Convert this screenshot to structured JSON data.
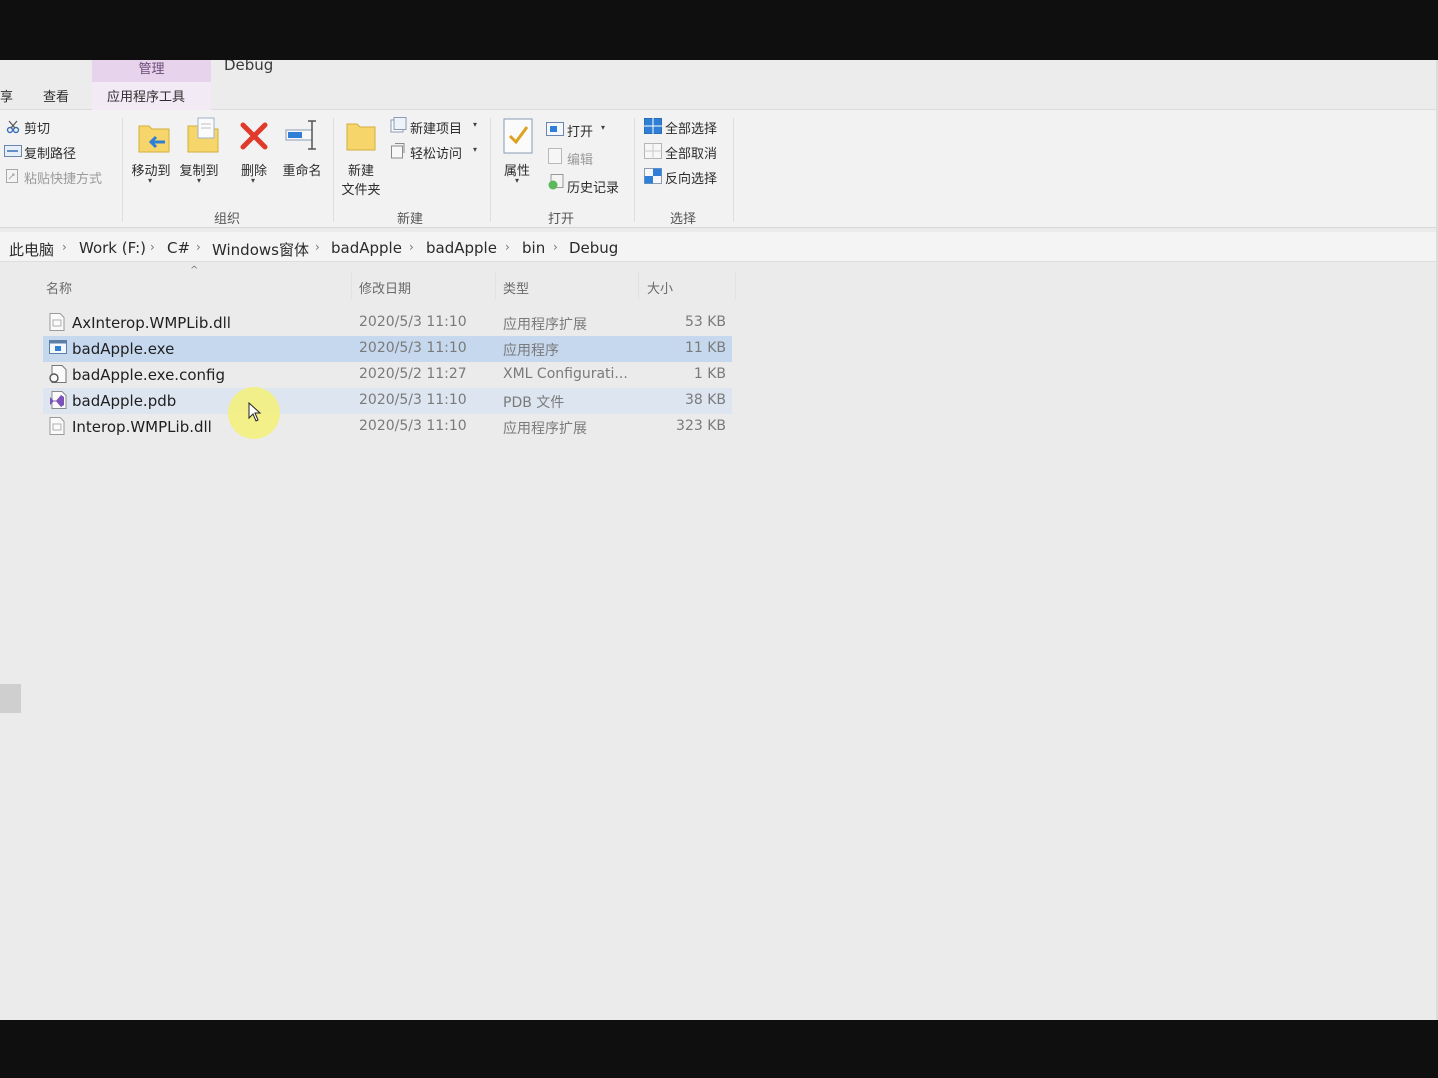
{
  "window": {
    "title": "Debug",
    "context_group": "管理",
    "tabs": [
      {
        "label": "享"
      },
      {
        "label": "查看"
      },
      {
        "label": "应用程序工具"
      }
    ]
  },
  "ribbon": {
    "clipboard": {
      "cut": "剪切",
      "copy_path": "复制路径",
      "paste_shortcut": "粘贴快捷方式"
    },
    "organize": {
      "label": "组织",
      "move_to": "移动到",
      "copy_to": "复制到",
      "delete": "删除",
      "rename": "重命名"
    },
    "new": {
      "label": "新建",
      "new_folder_line1": "新建",
      "new_folder_line2": "文件夹",
      "new_item": "新建项目",
      "easy_access": "轻松访问"
    },
    "open": {
      "label": "打开",
      "properties": "属性",
      "open": "打开",
      "edit": "编辑",
      "history": "历史记录"
    },
    "select": {
      "label": "选择",
      "select_all": "全部选择",
      "select_none": "全部取消",
      "invert": "反向选择"
    }
  },
  "breadcrumb": [
    "此电脑",
    "Work (F:)",
    "C#",
    "Windows窗体",
    "badApple",
    "badApple",
    "bin",
    "Debug"
  ],
  "columns": {
    "name": "名称",
    "date": "修改日期",
    "type": "类型",
    "size": "大小"
  },
  "files": [
    {
      "name": "AxInterop.WMPLib.dll",
      "date": "2020/5/3 11:10",
      "type": "应用程序扩展",
      "size": "53 KB",
      "icon": "dll-icon",
      "state": "normal"
    },
    {
      "name": "badApple.exe",
      "date": "2020/5/3 11:10",
      "type": "应用程序",
      "size": "11 KB",
      "icon": "exe-icon",
      "state": "selected"
    },
    {
      "name": "badApple.exe.config",
      "date": "2020/5/2 11:27",
      "type": "XML Configurati...",
      "size": "1 KB",
      "icon": "config-icon",
      "state": "normal"
    },
    {
      "name": "badApple.pdb",
      "date": "2020/5/3 11:10",
      "type": "PDB 文件",
      "size": "38 KB",
      "icon": "pdb-icon",
      "state": "hover"
    },
    {
      "name": "Interop.WMPLib.dll",
      "date": "2020/5/3 11:10",
      "type": "应用程序扩展",
      "size": "323 KB",
      "icon": "dll-icon",
      "state": "normal"
    }
  ],
  "colors": {
    "selected_row": "#c6d8ed",
    "hover_row": "#dde6f0",
    "context_tab": "#e7d4ec",
    "delete_red": "#e03a2a",
    "accent_blue": "#2f7fd6"
  }
}
